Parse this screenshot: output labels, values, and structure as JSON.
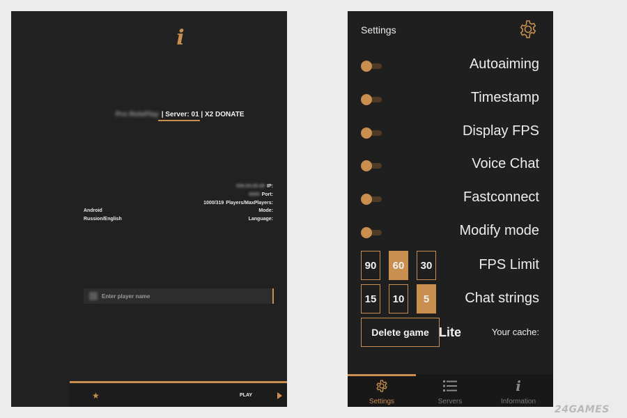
{
  "left": {
    "server": {
      "name": "Pro RolePlay",
      "info": "| Server: 01 | X2 DONATE"
    },
    "info_rows": [
      {
        "left": "",
        "right_value": "000.00.00.00",
        "right_key": "IP:"
      },
      {
        "left": "",
        "right_value": "0000",
        "right_key": "Port:"
      },
      {
        "left": "",
        "right_value": "1000/319",
        "right_key": "Players/MaxPlayers:"
      },
      {
        "left": "Android",
        "right_value": "",
        "right_key": "Mode:"
      },
      {
        "left": "Russion/English",
        "right_value": "",
        "right_key": "Language:"
      }
    ],
    "player_name_placeholder": "Enter player name",
    "play_label": "PLAY"
  },
  "right": {
    "title": "Settings",
    "toggles": [
      {
        "label": "Autoaiming",
        "enabled": true
      },
      {
        "label": "Timestamp",
        "enabled": true
      },
      {
        "label": "Display FPS",
        "enabled": true
      },
      {
        "label": "Voice Chat",
        "enabled": true
      },
      {
        "label": "Fastconnect",
        "enabled": true
      },
      {
        "label": "Modify mode",
        "enabled": true
      }
    ],
    "fps_limit": {
      "label": "FPS Limit",
      "options": [
        "90",
        "60",
        "30"
      ],
      "selected": "60"
    },
    "chat_strings": {
      "label": "Chat strings",
      "options": [
        "15",
        "10",
        "5"
      ],
      "selected": "5"
    },
    "delete_button": "Delete game",
    "lite_label": "Lite",
    "cache_label": "Your cache:",
    "tabs": [
      {
        "label": "Settings",
        "icon": "gear-icon",
        "active": true
      },
      {
        "label": "Servers",
        "icon": "list-icon",
        "active": false
      },
      {
        "label": "Information",
        "icon": "info-icon",
        "active": false
      }
    ]
  },
  "watermark": "24GAMES",
  "colors": {
    "accent": "#c88f4e",
    "panel": "#1f1f1f",
    "background": "#ececec"
  }
}
